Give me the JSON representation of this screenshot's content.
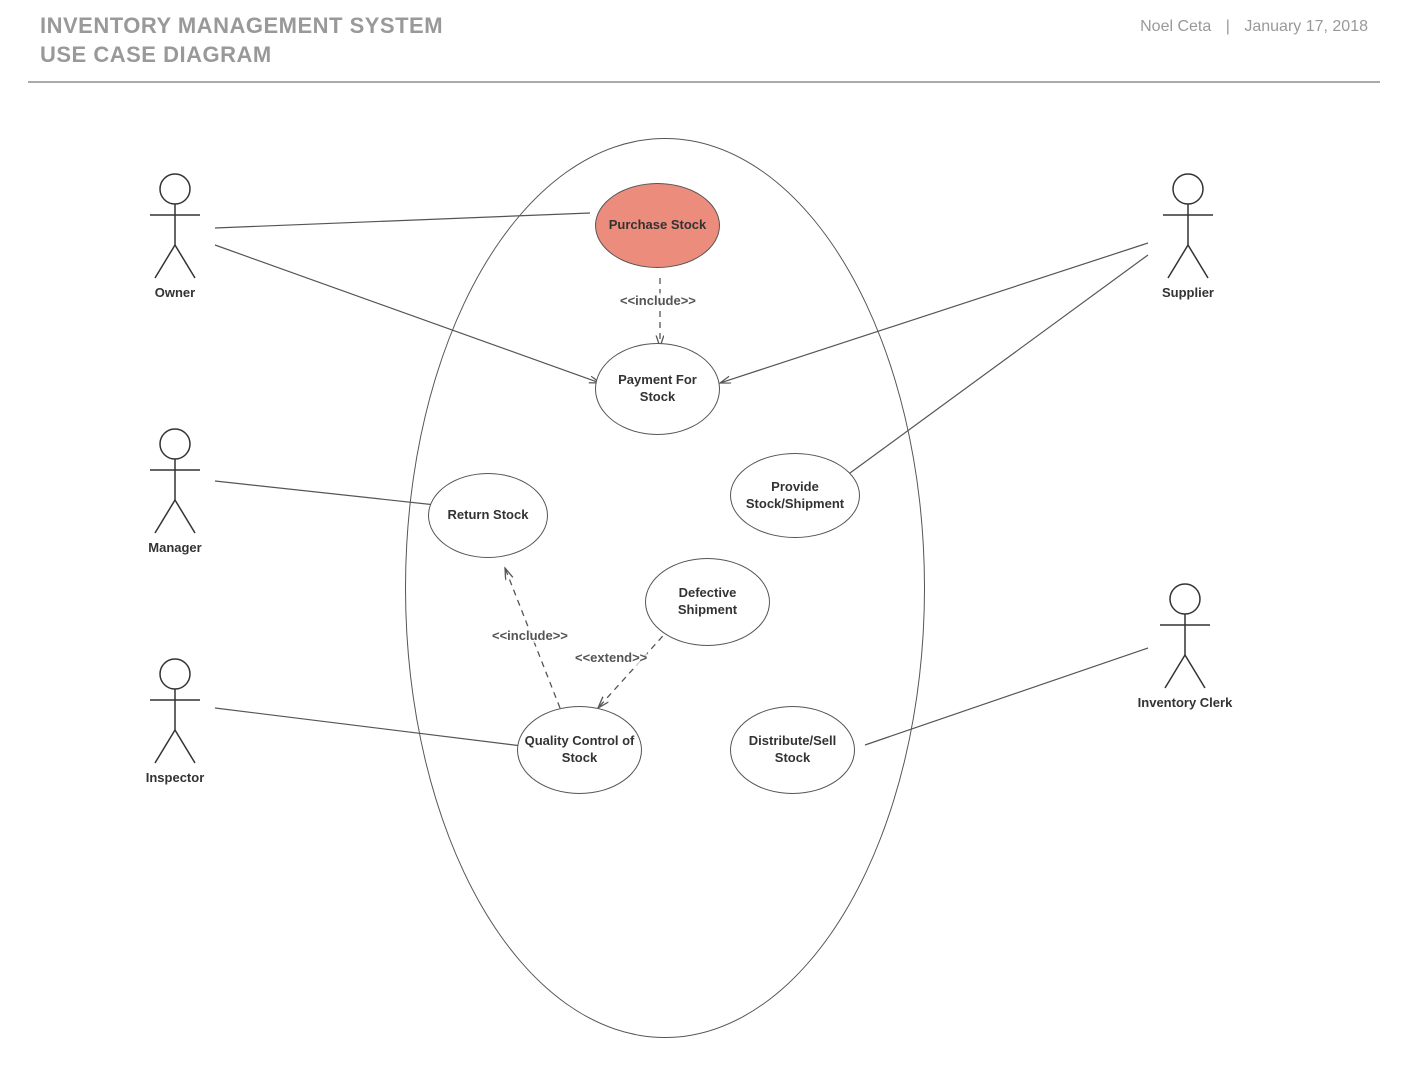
{
  "header": {
    "title_line1": "INVENTORY MANAGEMENT SYSTEM",
    "title_line2": "USE CASE DIAGRAM",
    "author": "Noel Ceta",
    "date": "January 17, 2018"
  },
  "actors": {
    "owner": "Owner",
    "manager": "Manager",
    "inspector": "Inspector",
    "supplier": "Supplier",
    "inventory_clerk": "Inventory Clerk"
  },
  "usecases": {
    "purchase_stock": "Purchase Stock",
    "payment_for_stock": "Payment For Stock",
    "return_stock": "Return Stock",
    "provide_stock_shipment": "Provide Stock/Shipment",
    "defective_shipment": "Defective Shipment",
    "quality_control": "Quality Control of Stock",
    "distribute_sell": "Distribute/Sell Stock"
  },
  "relationships": {
    "include1": "<<include>>",
    "include2": "<<include>>",
    "extend1": "<<extend>>"
  },
  "colors": {
    "highlight": "#ec8c7c",
    "stroke": "#555"
  }
}
